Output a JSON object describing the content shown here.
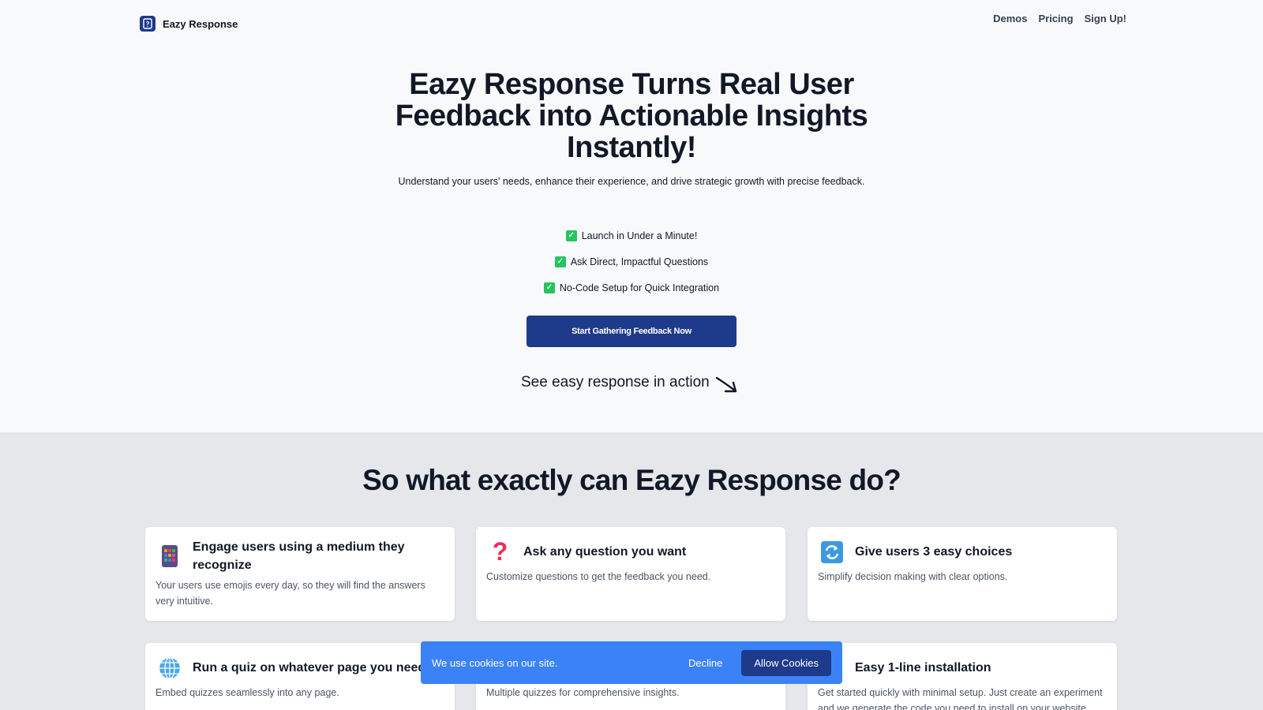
{
  "brand": {
    "name": "Eazy Response"
  },
  "nav": {
    "links": [
      "Demos",
      "Pricing",
      "Sign Up!"
    ]
  },
  "hero": {
    "title": "Eazy Response Turns Real User Feedback into Actionable Insights Instantly!",
    "subtitle": "Understand your users' needs, enhance their experience, and drive strategic growth with precise feedback.",
    "checks": [
      "Launch in Under a Minute!",
      "Ask Direct, Impactful Questions",
      "No-Code Setup for Quick Integration"
    ],
    "cta_label": "Start Gathering Feedback Now",
    "action_text": "See easy response in action"
  },
  "features": {
    "title": "So what exactly can Eazy Response do?",
    "cards": [
      {
        "icon": "grid-phone-icon",
        "title": "Engage users using a medium they recognize",
        "desc": "Your users use emojis every day, so they will find the answers very intuitive."
      },
      {
        "icon": "question-mark-icon",
        "title": "Ask any question you want",
        "desc": "Customize questions to get the feedback you need."
      },
      {
        "icon": "refresh-arrows-icon",
        "title": "Give users 3 easy choices",
        "desc": "Simplify decision making with clear options."
      },
      {
        "icon": "globe-icon",
        "title": "Run a quiz on whatever page you need to",
        "desc": "Embed quizzes seamlessly into any page."
      },
      {
        "icon": "",
        "title": "",
        "desc": "Multiple quizzes for comprehensive insights."
      },
      {
        "icon": "pin-icon",
        "title": "Easy 1-line installation",
        "desc": "Get started quickly with minimal setup. Just create an experiment and we generate the code you need to install on your website."
      }
    ]
  },
  "cookie": {
    "text": "We use cookies on our site.",
    "decline_label": "Decline",
    "allow_label": "Allow Cookies"
  },
  "colors": {
    "primary": "#1e3a8a",
    "cookie_bg": "#3b82f6",
    "check": "#22c55e",
    "section_bg": "#e5e7eb"
  }
}
